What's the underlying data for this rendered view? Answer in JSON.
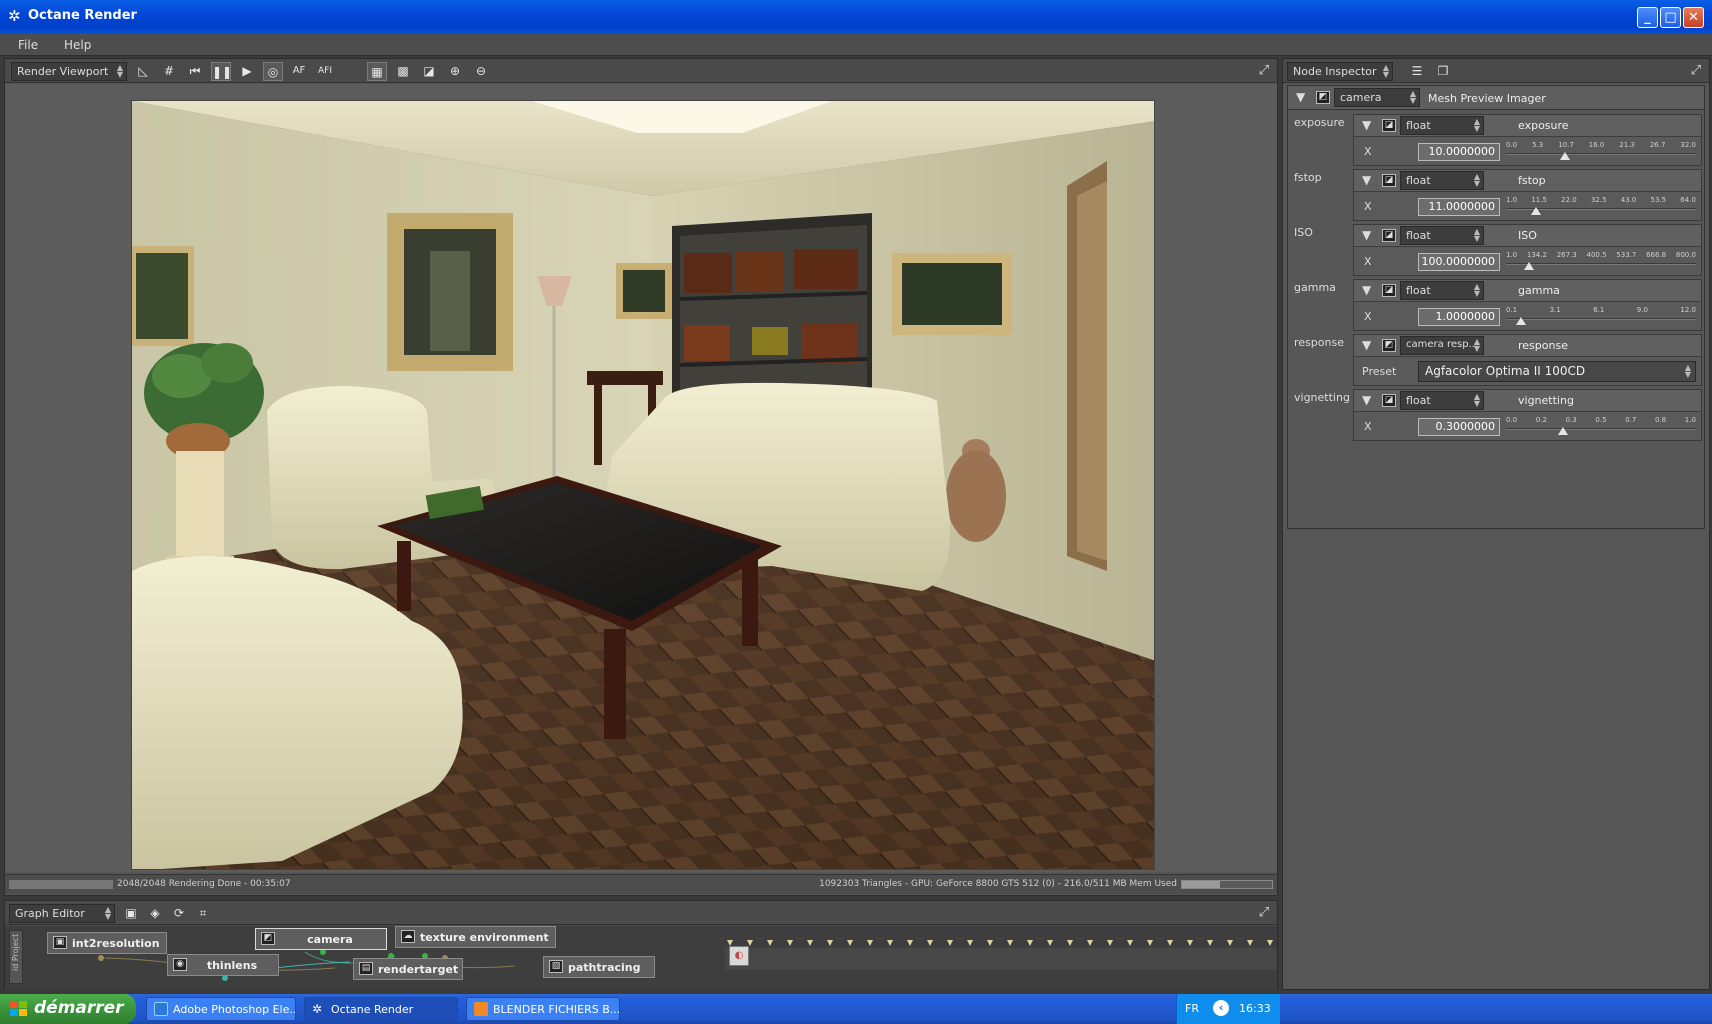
{
  "window": {
    "title": "Octane Render"
  },
  "menu": [
    "File",
    "Help"
  ],
  "viewport": {
    "mode": "Render Viewport",
    "toolbar_labels": {
      "af": "AF",
      "afi": "AFI"
    }
  },
  "status": {
    "left": "2048/2048 Rendering Done - 00:35:07",
    "right": "1092303 Triangles - GPU: GeForce 8800 GTS 512 (0) - 216.0/511 MB Mem Used",
    "render_progress": 1.0,
    "mem_used_fraction": 0.42
  },
  "graph": {
    "title": "Graph Editor",
    "side_tab": "id Project",
    "nodes": [
      "int2resolution",
      "camera",
      "texture environment",
      "thinlens",
      "rendertarget",
      "pathtracing"
    ]
  },
  "inspector": {
    "title": "Node Inspector",
    "node": "camera",
    "node_title": "Mesh Preview Imager",
    "params": [
      {
        "label": "exposure",
        "type": "float",
        "name": "exposure",
        "x": "10.0000000",
        "ticks": [
          "0.0",
          "5.3",
          "10.7",
          "16.0",
          "21.3",
          "26.7",
          "32.0"
        ],
        "fraction": 0.31
      },
      {
        "label": "fstop",
        "type": "float",
        "name": "fstop",
        "x": "11.0000000",
        "ticks": [
          "1.0",
          "11.5",
          "22.0",
          "32.5",
          "43.0",
          "53.5",
          "64.0"
        ],
        "fraction": 0.16
      },
      {
        "label": "ISO",
        "type": "float",
        "name": "ISO",
        "x": "100.0000000",
        "ticks": [
          "1.0",
          "134.2",
          "267.3",
          "400.5",
          "533.7",
          "666.8",
          "800.0"
        ],
        "fraction": 0.12
      },
      {
        "label": "gamma",
        "type": "float",
        "name": "gamma",
        "x": "1.0000000",
        "ticks": [
          "0.1",
          "3.1",
          "6.1",
          "9.0",
          "12.0"
        ],
        "fraction": 0.08
      },
      {
        "label": "response",
        "type": "camera resp...",
        "name": "response",
        "preset_label": "Preset",
        "preset": "Agfacolor Optima II 100CD"
      },
      {
        "label": "vignetting",
        "type": "float",
        "name": "vignetting",
        "x": "0.3000000",
        "ticks": [
          "0.0",
          "0.2",
          "0.3",
          "0.5",
          "0.7",
          "0.8",
          "1.0"
        ],
        "fraction": 0.3
      }
    ],
    "x_label": "X"
  },
  "taskbar": {
    "start": "démarrer",
    "tasks": [
      "Adobe Photoshop Ele...",
      "Octane Render",
      "BLENDER FICHIERS B..."
    ],
    "lang": "FR",
    "time": "16:33"
  }
}
